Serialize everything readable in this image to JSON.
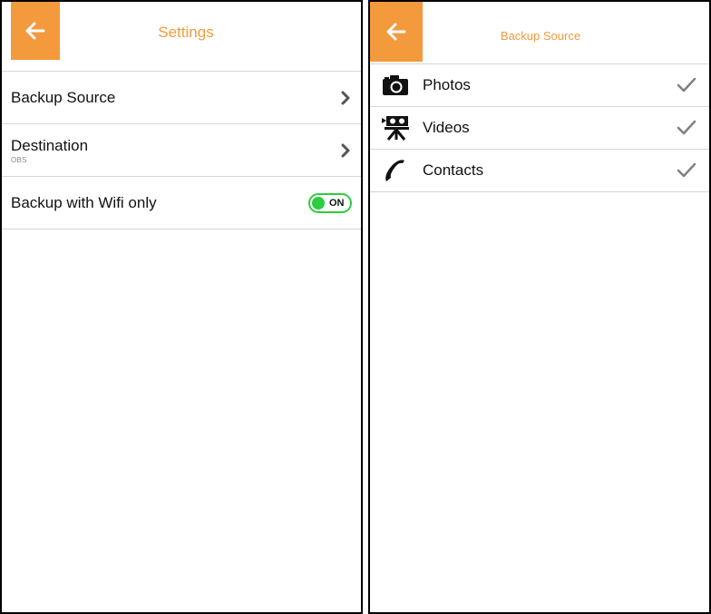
{
  "settings": {
    "title": "Settings",
    "rows": [
      {
        "label": "Backup Source"
      },
      {
        "label": "Destination",
        "sublabel": "OBS"
      },
      {
        "label": "Backup with Wifi only",
        "toggle": "ON"
      }
    ]
  },
  "backup_source": {
    "title": "Backup Source",
    "items": [
      {
        "label": "Photos",
        "icon": "camera-icon",
        "checked": true
      },
      {
        "label": "Videos",
        "icon": "video-camera-icon",
        "checked": true
      },
      {
        "label": "Contacts",
        "icon": "phone-icon",
        "checked": true
      }
    ]
  },
  "colors": {
    "accent": "#f39a3d",
    "toggle_on": "#2ecc40",
    "check": "#808080"
  }
}
